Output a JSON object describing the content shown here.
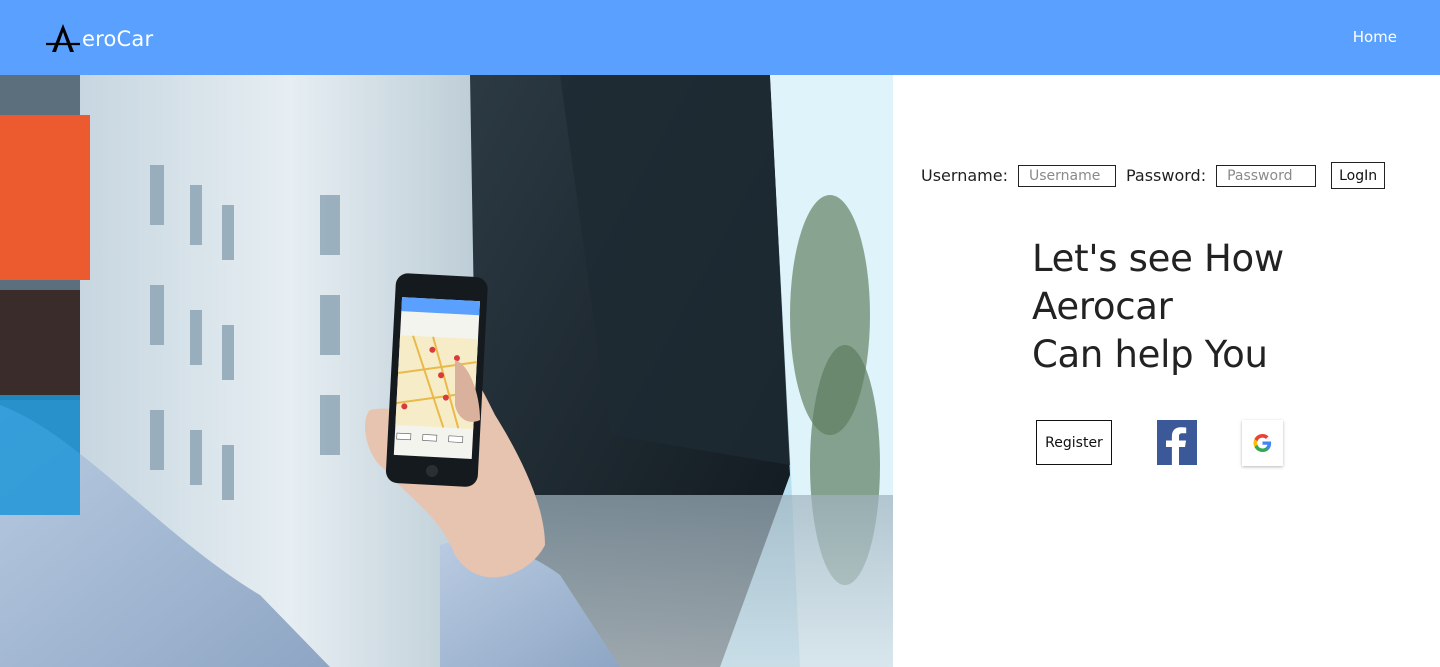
{
  "navbar": {
    "brand_text": "eroCar",
    "home_label": "Home",
    "background_color": "#5aa0ff"
  },
  "login": {
    "username_label": "Username:",
    "username_placeholder": "Username",
    "username_value": "",
    "password_label": "Password:",
    "password_placeholder": "Password",
    "password_value": "",
    "login_button": "LogIn"
  },
  "headline": {
    "line1": "Let's see How",
    "line2": "Aerocar",
    "line3": "Can help You"
  },
  "actions": {
    "register_label": "Register",
    "facebook_icon": "facebook-icon",
    "google_icon": "google-icon",
    "facebook_color": "#3b5998"
  },
  "icons": {
    "brand_logo": "aerocar-logo-icon"
  }
}
